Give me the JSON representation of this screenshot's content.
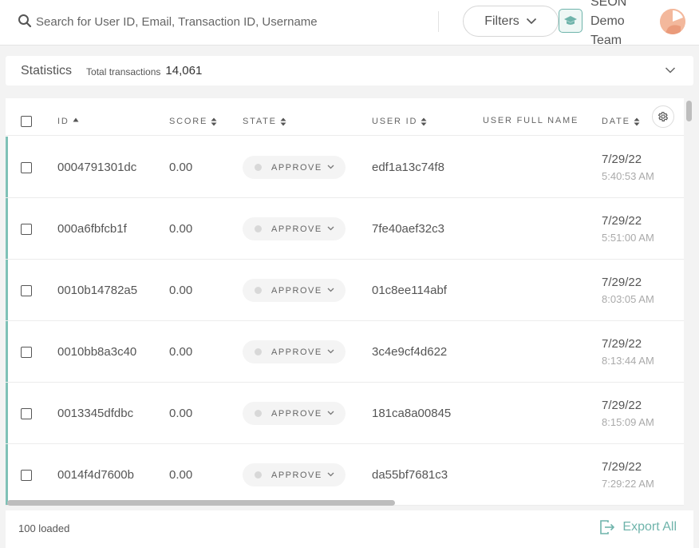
{
  "header": {
    "search_placeholder": "Search for User ID, Email, Transaction ID, Username",
    "filters_label": "Filters",
    "team_name_lines": [
      "SEON",
      "Demo",
      "Team"
    ]
  },
  "stats": {
    "title": "Statistics",
    "total_label": "Total transactions",
    "total_value": "14,061"
  },
  "table": {
    "columns": {
      "id": "ID",
      "score": "SCORE",
      "state": "STATE",
      "user_id": "USER ID",
      "user_full_name": "USER FULL NAME",
      "date": "DATE"
    },
    "rows": [
      {
        "id": "0004791301dc",
        "score": "0.00",
        "state": "APPROVE",
        "user_id": "edf1a13c74f8",
        "user_full_name": "",
        "date": "7/29/22",
        "time": "5:40:53 AM"
      },
      {
        "id": "000a6fbfcb1f",
        "score": "0.00",
        "state": "APPROVE",
        "user_id": "7fe40aef32c3",
        "user_full_name": "",
        "date": "7/29/22",
        "time": "5:51:00 AM"
      },
      {
        "id": "0010b14782a5",
        "score": "0.00",
        "state": "APPROVE",
        "user_id": "01c8ee114abf",
        "user_full_name": "",
        "date": "7/29/22",
        "time": "8:03:05 AM"
      },
      {
        "id": "0010bb8a3c40",
        "score": "0.00",
        "state": "APPROVE",
        "user_id": "3c4e9cf4d622",
        "user_full_name": "",
        "date": "7/29/22",
        "time": "8:13:44 AM"
      },
      {
        "id": "0013345dfdbc",
        "score": "0.00",
        "state": "APPROVE",
        "user_id": "181ca8a00845",
        "user_full_name": "",
        "date": "7/29/22",
        "time": "8:15:09 AM"
      },
      {
        "id": "0014f4d7600b",
        "score": "0.00",
        "state": "APPROVE",
        "user_id": "da55bf7681c3",
        "user_full_name": "",
        "date": "7/29/22",
        "time": "7:29:22 AM"
      }
    ]
  },
  "footer": {
    "loaded_text": "100 loaded",
    "export_label": "Export All"
  },
  "colors": {
    "accent": "#6fb4ab",
    "row_accent": "#7fc1b7",
    "state_dot": "#d8d8d8"
  },
  "icons": {
    "search": "search-icon",
    "filters_chevron": "chevron-down-icon",
    "team": "graduation-cap-icon",
    "avatar": "avatar",
    "settings": "gear-icon",
    "export": "export-icon",
    "sort": "sort-icon"
  }
}
